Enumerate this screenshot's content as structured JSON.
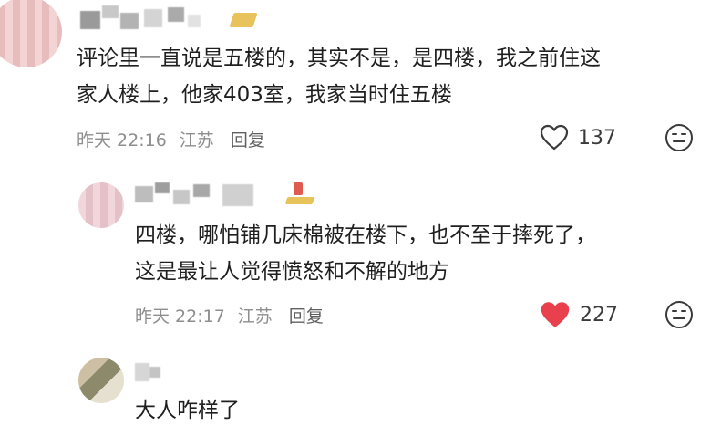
{
  "comments": [
    {
      "text_line1": "评论里一直说是五楼的，其实不是，是四楼，我之前住这",
      "text_line2": "家人楼上，他家403室，我家当时住五楼",
      "time": "昨天 22:16",
      "location": "江苏",
      "reply_label": "回复",
      "likes": "137",
      "liked": false
    },
    {
      "text_line1": "四楼，哪怕铺几床棉被在楼下，也不至于摔死了，",
      "text_line2": "这是最让人觉得愤怒和不解的地方",
      "time": "昨天 22:17",
      "location": "江苏",
      "reply_label": "回复",
      "likes": "227",
      "liked": true
    },
    {
      "text_line1": "大人咋样了"
    }
  ],
  "colors": {
    "liked_heart": "#e8404d",
    "meta_text": "#8e8e8e",
    "badge_gold": "#e8c25a",
    "badge_red": "#e05a50"
  },
  "icons": {
    "like": "heart-icon",
    "emoji": "emoji-icon"
  }
}
